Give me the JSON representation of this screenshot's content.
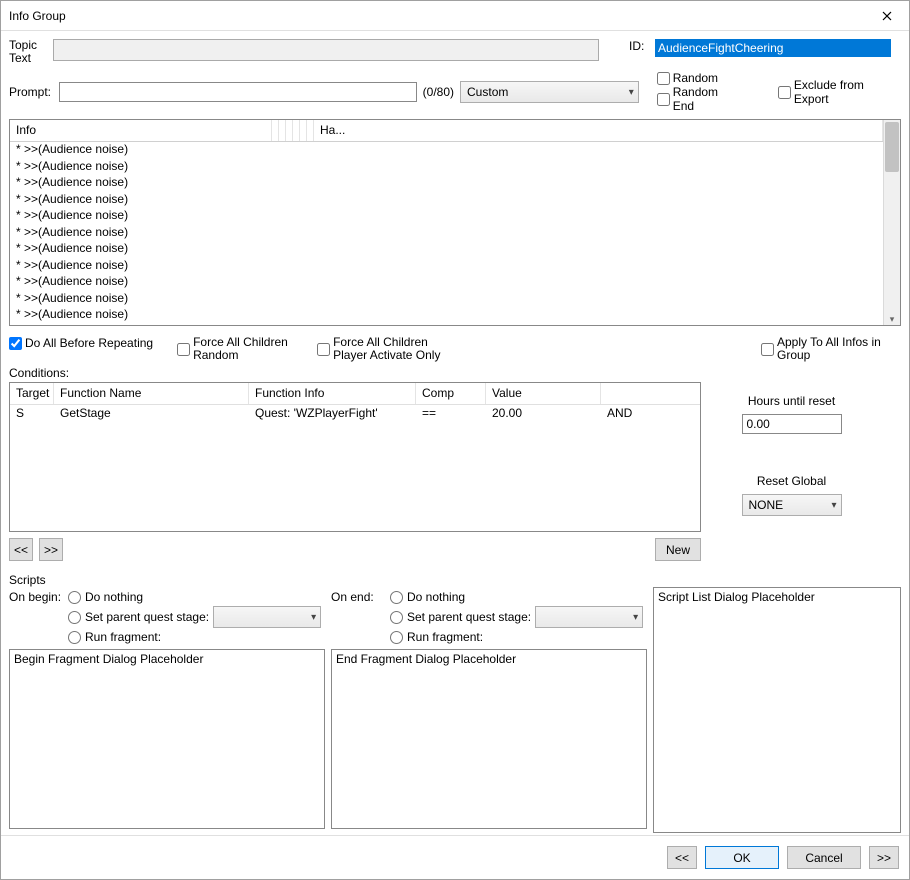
{
  "window": {
    "title": "Info Group"
  },
  "topic": {
    "label": "Topic Text",
    "id_label": "ID:",
    "id_value": "AudienceFightCheering"
  },
  "prompt": {
    "label": "Prompt:",
    "value": "",
    "counter": "(0/80)",
    "emotion_options": [
      "Custom"
    ],
    "emotion_selected": "Custom"
  },
  "flags": {
    "random": "Random",
    "random_end": "Random End",
    "exclude_export": "Exclude from Export"
  },
  "info_list": {
    "header_info": "Info",
    "header_ha": "Ha...",
    "rows": [
      "* >>(Audience noise)",
      "* >>(Audience noise)",
      "* >>(Audience noise)",
      "* >>(Audience noise)",
      "* >>(Audience noise)",
      "* >>(Audience noise)",
      "* >>(Audience noise)",
      "* >>(Audience noise)",
      "* >>(Audience noise)",
      "* >>(Audience noise)",
      "* >>(Audience noise)"
    ]
  },
  "mid": {
    "do_all": "Do All Before Repeating",
    "force_random": "Force All Children Random",
    "force_player": "Force All Children Player Activate Only",
    "apply_all": "Apply To All Infos in Group",
    "conditions_label": "Conditions:"
  },
  "conditions": {
    "headers": {
      "target": "Target",
      "fn": "Function Name",
      "fi": "Function Info",
      "comp": "Comp",
      "val": "Value",
      "last": ""
    },
    "row": {
      "target": "S",
      "fn": "GetStage",
      "fi": "Quest: 'WZPlayerFight'",
      "comp": "==",
      "val": "20.00",
      "last": "AND"
    },
    "nav_prev": "<<",
    "nav_next": ">>",
    "new_btn": "New"
  },
  "reset": {
    "hours_label": "Hours until reset",
    "hours_value": "0.00",
    "global_label": "Reset Global",
    "global_value": "NONE"
  },
  "scripts": {
    "label": "Scripts",
    "on_begin": "On begin:",
    "on_end": "On end:",
    "opt_nothing": "Do nothing",
    "opt_stage": "Set parent quest stage:",
    "opt_fragment": "Run fragment:",
    "begin_placeholder": "Begin Fragment Dialog Placeholder",
    "end_placeholder": "End Fragment Dialog Placeholder",
    "list_placeholder": "Script List Dialog Placeholder"
  },
  "bottom": {
    "prev": "<<",
    "ok": "OK",
    "cancel": "Cancel",
    "next": ">>"
  }
}
